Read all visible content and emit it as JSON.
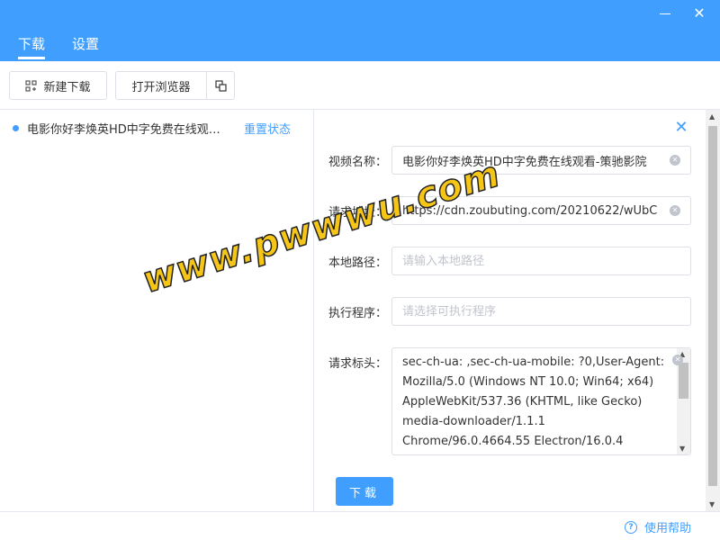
{
  "window": {
    "minimize_label": "—",
    "close_label": "✕"
  },
  "tabs": [
    {
      "label": "下载",
      "active": true
    },
    {
      "label": "设置",
      "active": false
    }
  ],
  "toolbar": {
    "new_download_label": "新建下载",
    "open_browser_label": "打开浏览器"
  },
  "downloads": [
    {
      "title": "电影你好李焕英HD中字免费在线观看-策驰影院",
      "action_label": "重置状态"
    }
  ],
  "form": {
    "close_label": "✕",
    "video_name": {
      "label": "视频名称：",
      "value": "电影你好李焕英HD中字免费在线观看-策驰影院"
    },
    "request_url": {
      "label": "请求地址：",
      "value": "https://cdn.zoubuting.com/20210622/wUbC"
    },
    "local_path": {
      "label": "本地路径：",
      "placeholder": "请输入本地路径"
    },
    "executable": {
      "label": "执行程序：",
      "placeholder": "请选择可执行程序"
    },
    "headers": {
      "label": "请求标头：",
      "value": "sec-ch-ua: ,sec-ch-ua-mobile: ?0,User-Agent: Mozilla/5.0 (Windows NT 10.0; Win64; x64) AppleWebKit/537.36 (KHTML, like Gecko) media-downloader/1.1.1 Chrome/96.0.4664.55 Electron/16.0.4"
    },
    "download_label": "下载"
  },
  "footer": {
    "help_label": "使用帮助"
  },
  "watermark": "www.pwwwu.com",
  "colors": {
    "accent": "#409eff",
    "watermark": "#f5c518"
  }
}
